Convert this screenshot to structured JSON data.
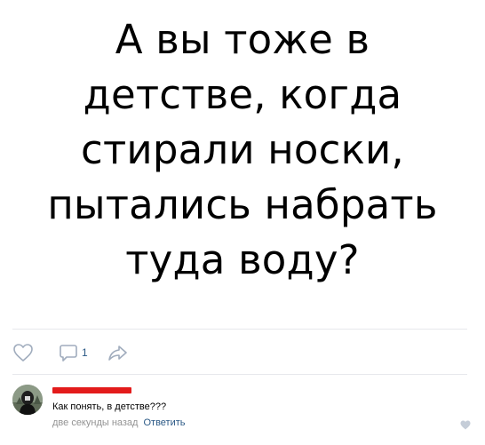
{
  "post": {
    "lines": [
      "А вы тоже в",
      "детстве, когда",
      "стирали носки,",
      "пытались набрать",
      "туда воду?"
    ]
  },
  "actions": {
    "like_icon": "heart-outline-icon",
    "comment_icon": "comment-bubble-icon",
    "comment_count": "1",
    "share_icon": "share-arrow-icon"
  },
  "comment": {
    "author_redacted": true,
    "redaction_color": "#e31b1b",
    "text": "Как понять, в детстве???",
    "time": "две секунды назад",
    "reply_label": "Ответить",
    "like_icon": "heart-small-icon"
  },
  "colors": {
    "link": "#2a5885",
    "meta": "#939393",
    "icon": "#a0acbd"
  }
}
